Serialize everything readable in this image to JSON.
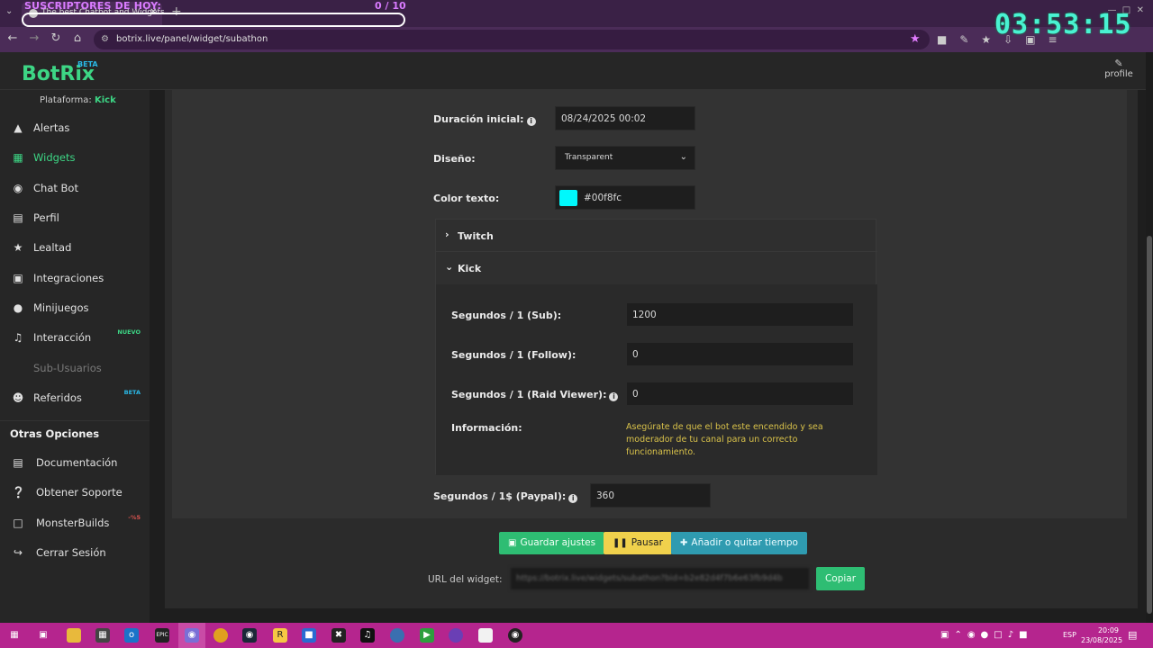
{
  "overlay": {
    "subscribers_label": "SUSCRIPTORES DE HOY:",
    "subscribers_count": "0  / 10",
    "timer": "03:53:15"
  },
  "browser": {
    "tab_title": "The best Chatbot and Widgets",
    "url": "botrix.live/panel/widget/subathon"
  },
  "app": {
    "logo": "BotRix",
    "logo_badge": "BETA",
    "profile_label": "profile",
    "platform_label": "Plataforma:",
    "platform_value": "Kick"
  },
  "sidebar": {
    "items": [
      {
        "label": "Alertas",
        "icon": "warning-icon"
      },
      {
        "label": "Widgets",
        "icon": "grid-icon"
      },
      {
        "label": "Chat Bot",
        "icon": "robot-icon"
      },
      {
        "label": "Perfil",
        "icon": "id-card-icon"
      },
      {
        "label": "Lealtad",
        "icon": "trophy-icon"
      },
      {
        "label": "Integraciones",
        "icon": "integration-icon"
      },
      {
        "label": "Minijuegos",
        "icon": "gamepad-icon"
      },
      {
        "label": "Interacción",
        "icon": "music-icon",
        "badge": "NUEVO"
      },
      {
        "label": "Sub-Usuarios",
        "icon": "user-icon"
      },
      {
        "label": "Referidos",
        "icon": "users-icon",
        "badge": "BETA"
      }
    ],
    "other_title": "Otras Opciones",
    "other_items": [
      {
        "label": "Documentación",
        "icon": "document-icon"
      },
      {
        "label": "Obtener Soporte",
        "icon": "question-icon"
      },
      {
        "label": "MonsterBuilds",
        "icon": "laptop-icon",
        "badge": "-%5"
      },
      {
        "label": "Cerrar Sesión",
        "icon": "logout-icon"
      }
    ]
  },
  "form": {
    "initial_duration_label": "Duración inicial:",
    "initial_duration_value": "08/24/2025 00:02",
    "design_label": "Diseño:",
    "design_value": "Transparent",
    "text_color_label": "Color texto:",
    "text_color_value": "#00f8fc",
    "twitch_label": "Twitch",
    "kick_label": "Kick",
    "kick": {
      "sub_label": "Segundos / 1 (Sub):",
      "sub_value": "1200",
      "follow_label": "Segundos / 1 (Follow):",
      "follow_value": "0",
      "raid_label": "Segundos / 1 (Raid Viewer):",
      "raid_value": "0",
      "info_label": "Información:",
      "info_text": "Asegúrate de que el bot este encendido y sea moderador de tu canal para un correcto funcionamiento."
    },
    "paypal_label": "Segundos / 1$ (Paypal):",
    "paypal_value": "360"
  },
  "actions": {
    "save": "Guardar ajustes",
    "pause": "Pausar",
    "add_remove": "Añadir o quitar tiempo",
    "url_label": "URL del widget:",
    "url_value": "https://botrix.live/widgets/subathon?bid=b2e82d4f7b6e63fb9d4b",
    "copy": "Copiar"
  },
  "taskbar": {
    "lang": "ESP",
    "time": "20:09",
    "date": "23/08/2025"
  },
  "colors": {
    "accent_green": "#3dd685",
    "timer_cyan": "#49f2d2",
    "taskbar": "#b5258e",
    "browser_chrome": "#4b2c58"
  }
}
